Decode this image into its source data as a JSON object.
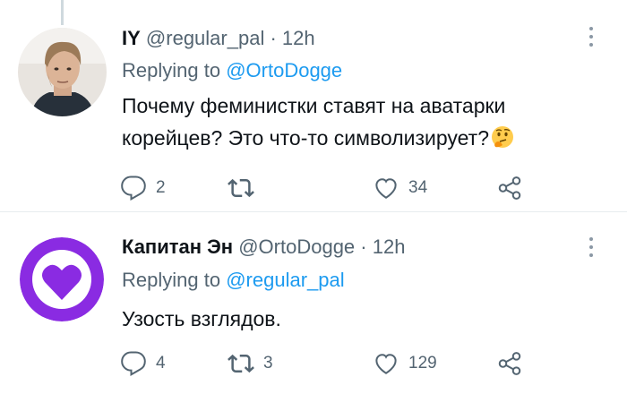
{
  "tweets": [
    {
      "name": "IY",
      "handle": "@regular_pal",
      "separator": "·",
      "time": "12h",
      "replying_prefix": "Replying to",
      "replying_to": "@OrtoDogge",
      "text": "Почему феминистки ставят на аватарки корейцев? Это что-то символизирует?",
      "emoji": "thinking-face",
      "replies": "2",
      "retweets": "",
      "likes": "34",
      "avatar": "photo-young-man",
      "more_icon": "more-vertical-icon"
    },
    {
      "name": "Капитан Эн",
      "handle": "@OrtoDogge",
      "separator": "·",
      "time": "12h",
      "replying_prefix": "Replying to",
      "replying_to": "@regular_pal",
      "text": "Узость взглядов.",
      "replies": "4",
      "retweets": "3",
      "likes": "129",
      "avatar": "purple-heart-circle",
      "more_icon": "more-vertical-icon"
    }
  ],
  "colors": {
    "text": "#0f1419",
    "muted": "#536471",
    "link": "#1d9bf0",
    "avatar_purple": "#8a2be2"
  },
  "icons": [
    "reply-icon",
    "retweet-icon",
    "like-icon",
    "share-icon"
  ]
}
